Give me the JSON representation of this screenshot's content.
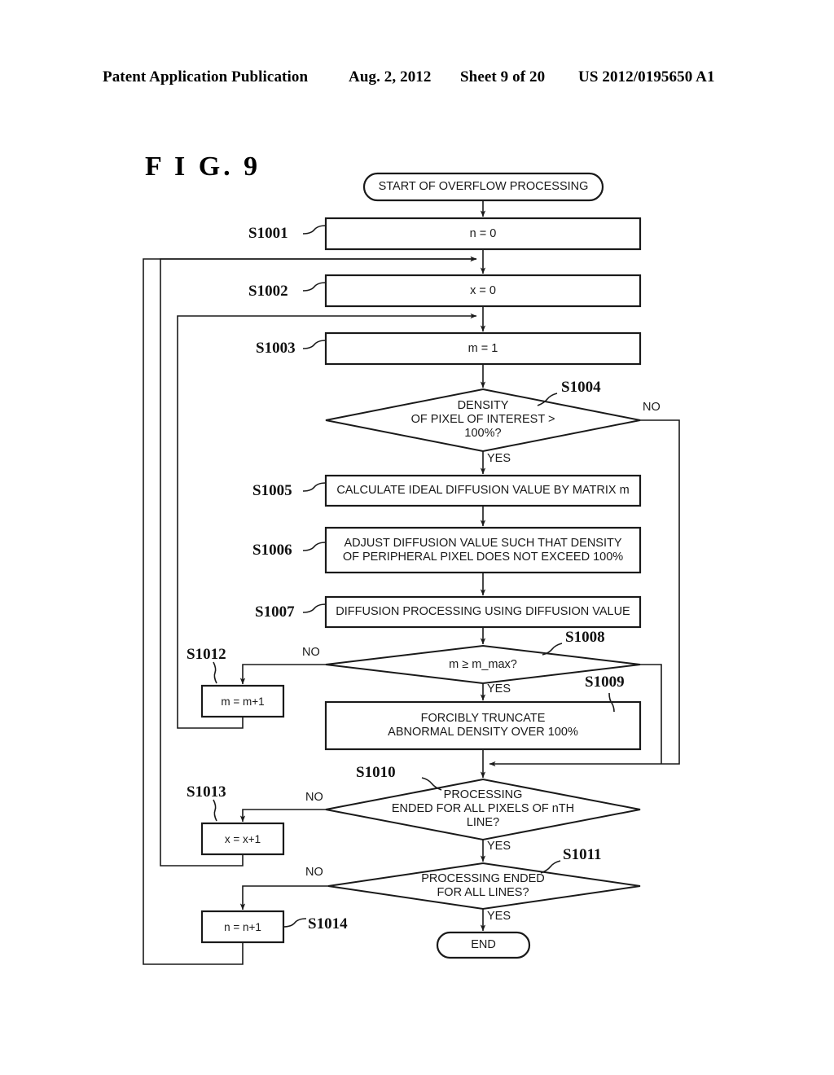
{
  "header": {
    "publication": "Patent Application Publication",
    "date": "Aug. 2, 2012",
    "sheet": "Sheet 9 of 20",
    "number": "US 2012/0195650 A1"
  },
  "figure": {
    "title": "F I G.  9"
  },
  "nodes": {
    "start": {
      "step": "",
      "text": "START OF OVERFLOW PROCESSING"
    },
    "s1001": {
      "step": "S1001",
      "text": "n = 0"
    },
    "s1002": {
      "step": "S1002",
      "text": "x = 0"
    },
    "s1003": {
      "step": "S1003",
      "text": "m = 1"
    },
    "s1004": {
      "step": "S1004",
      "text": "DENSITY\nOF PIXEL OF INTEREST >\n100%?"
    },
    "s1005": {
      "step": "S1005",
      "text": "CALCULATE IDEAL DIFFUSION VALUE BY MATRIX m"
    },
    "s1006": {
      "step": "S1006",
      "text": "ADJUST DIFFUSION VALUE SUCH THAT DENSITY\nOF PERIPHERAL PIXEL DOES NOT EXCEED 100%"
    },
    "s1007": {
      "step": "S1007",
      "text": "DIFFUSION PROCESSING USING DIFFUSION VALUE"
    },
    "s1008": {
      "step": "S1008",
      "text": "m ≥ m_max?"
    },
    "s1009": {
      "step": "S1009",
      "text": "FORCIBLY TRUNCATE\nABNORMAL DENSITY OVER 100%"
    },
    "s1010": {
      "step": "S1010",
      "text": "PROCESSING\nENDED FOR ALL PIXELS OF nTH\nLINE?"
    },
    "s1011": {
      "step": "S1011",
      "text": "PROCESSING ENDED\nFOR ALL LINES?"
    },
    "s1012": {
      "step": "S1012",
      "text": "m = m+1"
    },
    "s1013": {
      "step": "S1013",
      "text": "x = x+1"
    },
    "s1014": {
      "step": "S1014",
      "text": "n = n+1"
    },
    "end": {
      "step": "",
      "text": "END"
    }
  },
  "branches": {
    "s1004_no": "NO",
    "s1004_yes": "YES",
    "s1008_no": "NO",
    "s1008_yes": "YES",
    "s1010_no": "NO",
    "s1010_yes": "YES",
    "s1011_no": "NO",
    "s1011_yes": "YES"
  },
  "colors": {
    "stroke": "#1a1a1a",
    "background": "#ffffff"
  }
}
